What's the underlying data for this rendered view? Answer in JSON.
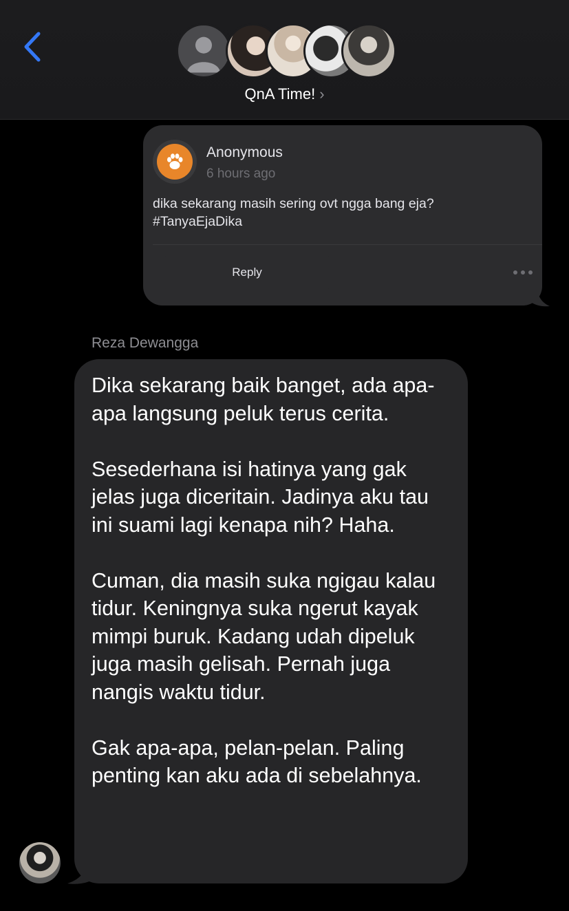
{
  "header": {
    "group_title": "QnA Time!",
    "group_chevron": "›",
    "back_icon": "chevron-left-icon",
    "accent_color": "#3478f6",
    "member_avatars": [
      "placeholder-person",
      "member-photo-1",
      "member-photo-2",
      "member-photo-3",
      "member-photo-4"
    ]
  },
  "question": {
    "author": "Anonymous",
    "time": "6 hours ago",
    "avatar_icon": "paw-icon",
    "avatar_color": "#e8862a",
    "text": "dika sekarang masih sering ovt ngga bang eja?\n#TanyaEjaDika",
    "reply_label": "Reply",
    "more_icon": "more-dots-icon"
  },
  "message": {
    "sender": "Reza Dewangga",
    "paragraphs": [
      "Dika sekarang baik banget, ada apa-apa langsung peluk terus cerita.",
      "Sesederhana isi hatinya yang gak jelas juga diceritain. Jadinya aku tau ini suami lagi kenapa nih? Haha.",
      "Cuman, dia masih suka ngigau kalau tidur. Keningnya suka ngerut kayak mimpi buruk. Kadang udah dipeluk juga masih gelisah. Pernah juga nangis waktu tidur.",
      "Gak apa-apa, pelan-pelan. Paling penting kan aku ada di sebelahnya."
    ]
  }
}
